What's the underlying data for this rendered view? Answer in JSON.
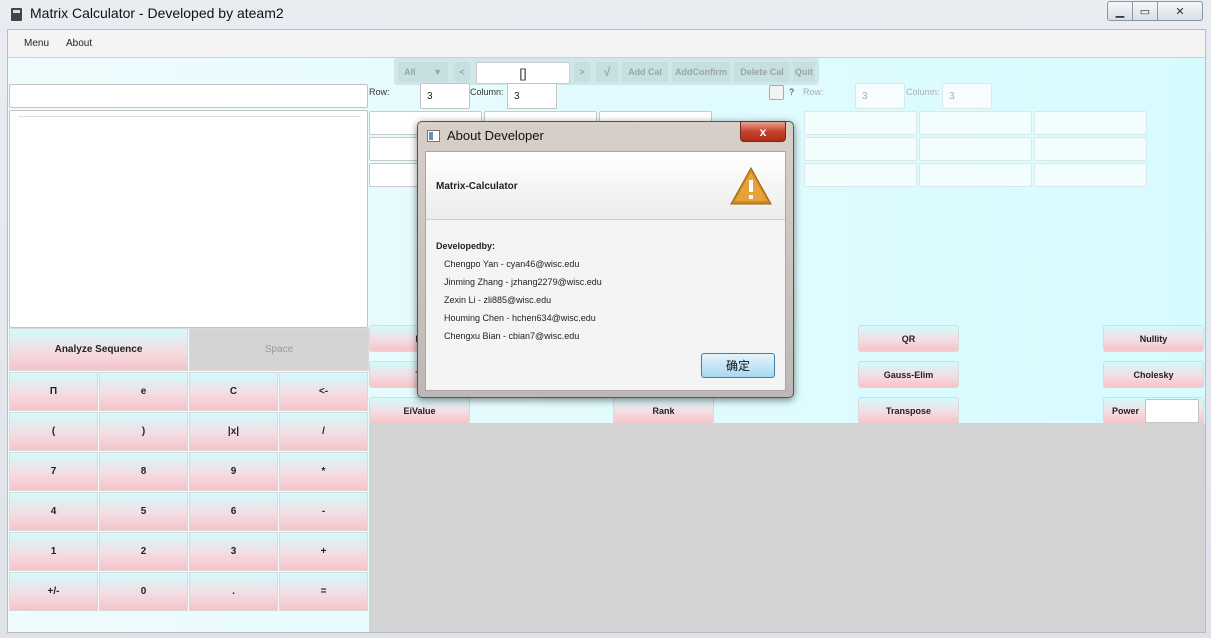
{
  "window": {
    "title": "Matrix Calculator - Developed by ateam2",
    "minimize_symbol": "▁",
    "maximize_symbol": "▭",
    "close_symbol": "✕"
  },
  "menu": {
    "items": [
      "Menu",
      "About"
    ]
  },
  "toolbar": {
    "type_select": "All",
    "prev": "<",
    "matrix_symbol": "[]",
    "next": ">",
    "sqrt": "√",
    "add_cal": "Add Cal",
    "add_confirm": "AddConfirm",
    "delete_cal": "Delete Cal",
    "quit": "Quit"
  },
  "left_matrix": {
    "row_label": "Row:",
    "row_value": "3",
    "column_label": "Column:",
    "column_value": "3"
  },
  "right_matrix": {
    "checkbox_label": "?",
    "row_label": "Row:",
    "row_value": "3",
    "column_label": "Column:",
    "column_value": "3"
  },
  "calc_pad": {
    "analyze": "Analyze Sequence",
    "space": "Space",
    "keys": [
      [
        "Π",
        "e",
        "C",
        "<-"
      ],
      [
        "(",
        ")",
        "|x|",
        "/"
      ],
      [
        "7",
        "8",
        "9",
        "*"
      ],
      [
        "4",
        "5",
        "6",
        "-"
      ],
      [
        "1",
        "2",
        "3",
        "+"
      ],
      [
        "+/-",
        "0",
        ".",
        "="
      ]
    ]
  },
  "operations": {
    "d_partial": "D",
    "tr_partial": "Tr",
    "eivalue": "EiValue",
    "rank": "Rank",
    "qr": "QR",
    "gauss": "Gauss-Elim",
    "transpose": "Transpose",
    "nullity": "Nullity",
    "cholesky": "Cholesky",
    "power_label": "Power"
  },
  "dialog": {
    "title": "About Developer",
    "close": "x",
    "heading": "Matrix-Calculator",
    "developed_by": "Developedby:",
    "developers": [
      "Chengpo Yan - cyan46@wisc.edu",
      "Jinming Zhang - jzhang2279@wisc.edu",
      "Zexin Li - zli885@wisc.edu",
      "Houming Chen - hchen634@wisc.edu",
      "Chengxu Bian - cbian7@wisc.edu"
    ],
    "ok": "确定",
    "warning_icon_color": "#d18a22"
  }
}
